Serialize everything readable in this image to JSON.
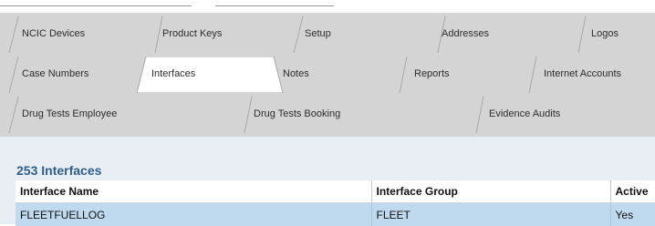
{
  "tabs": {
    "row1": [
      {
        "label": "NCIC Devices"
      },
      {
        "label": "Product Keys"
      },
      {
        "label": "Setup"
      },
      {
        "label": "Addresses"
      },
      {
        "label": "Logos"
      }
    ],
    "row2": [
      {
        "label": "Case Numbers"
      },
      {
        "label": "Interfaces",
        "active": true
      },
      {
        "label": "Notes"
      },
      {
        "label": "Reports"
      },
      {
        "label": "Internet Accounts"
      }
    ],
    "row3": [
      {
        "label": "Drug Tests Employee"
      },
      {
        "label": "Drug Tests Booking"
      },
      {
        "label": "Evidence Audits"
      }
    ]
  },
  "section": {
    "title": "253 Interfaces"
  },
  "table": {
    "columns": [
      "Interface Name",
      "Interface Group",
      "Active"
    ],
    "rows": [
      [
        "FLEETFUELLOG",
        "FLEET",
        "Yes"
      ]
    ]
  },
  "colors": {
    "tab_area": "#d4d4d4",
    "tab_active": "#ffffff",
    "title": "#2d5e8a",
    "row_highlight": "#bfd9ee"
  }
}
